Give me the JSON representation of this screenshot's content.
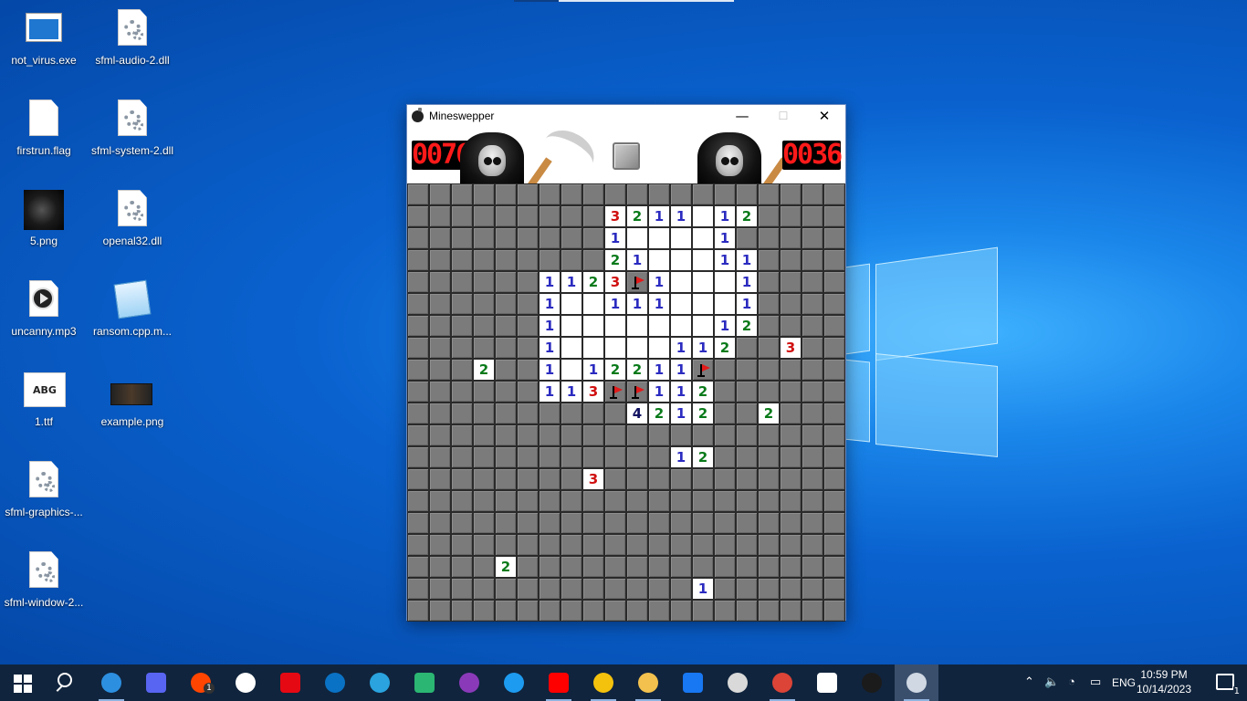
{
  "desktop": {
    "icons": [
      {
        "label": "not_virus.exe",
        "icon": "window-app-icon"
      },
      {
        "label": "sfml-audio-2.dll",
        "icon": "dll-gear-icon"
      },
      {
        "label": "firstrun.flag",
        "icon": "blank-file-icon"
      },
      {
        "label": "sfml-system-2.dll",
        "icon": "dll-gear-icon"
      },
      {
        "label": "5.png",
        "icon": "dark-face-image-icon"
      },
      {
        "label": "openal32.dll",
        "icon": "dll-gear-icon"
      },
      {
        "label": "uncanny.mp3",
        "icon": "audio-play-icon"
      },
      {
        "label": "ransom.cpp.m...",
        "icon": "notepad-file-icon"
      },
      {
        "label": "1.ttf",
        "icon": "font-file-icon",
        "glyph_text": "ABG"
      },
      {
        "label": "example.png",
        "icon": "image-thumbnail-icon"
      },
      {
        "label": "sfml-graphics-...",
        "icon": "dll-gear-icon"
      },
      {
        "label": "sfml-window-2...",
        "icon": "dll-gear-icon"
      }
    ]
  },
  "window": {
    "title": "Mineswepper",
    "minimize_glyph": "—",
    "maximize_glyph": "☐",
    "close_glyph": "✕",
    "left_counter": "0076",
    "right_counter": "0036",
    "counter_color": "#ff1a1a"
  },
  "board": {
    "cols": 20,
    "rows": 20,
    "legend": "H = hidden, O = open empty, F = flag, 1-4 = number",
    "grid": [
      "HHHHHHHHHHHHHHHHHHHH",
      "HHHHHHHHH3211 12HHHH",
      "HHHHHHHHH1OOOO1HHHHH",
      "HHHHHHHHH21OOO11HHHH",
      "HHHHHH1123F1OOO1HHHH",
      "HHHHHH1OO111OOO1HHHH",
      "HHHHHH1OOOOOOO12HHHH",
      "HHHHHH1OOOOO112HH3HH",
      "HHH2HH1O12211FHHHHHH",
      "HHHHHH113FF112HHHHHH",
      "HHHHHHHHHH4212HH2HHH",
      "HHHHHHHHHHHHHHHHHHHH",
      "HHHHHHHHHHHH12HHHHHH",
      "HHHHHHHH3HHHHHHHHHHH",
      "HHHHHHHHHHHHHHHHHHHH",
      "HHHHHHHHHHHHHHHHHHHH",
      "HHHHHHHHHHHHHHHHHHHH",
      "HHHH2HHHHHHHHHHHHHHH",
      "HHHHHHHHHHHHH1HHHHHH",
      "HHHHHHHHHHHHHHHHHHHH"
    ],
    "number_colors": {
      "1": "#2b2bc0",
      "2": "#0a7a1a",
      "3": "#d01010",
      "4": "#101060"
    }
  },
  "taskbar": {
    "apps": [
      {
        "name": "start-button",
        "color": "#ffffff"
      },
      {
        "name": "search-button",
        "color": "#ffffff"
      },
      {
        "name": "vscode-app",
        "color": "#2d8fe0"
      },
      {
        "name": "discord-app",
        "color": "#5865f2"
      },
      {
        "name": "reddit-app",
        "color": "#ff4500",
        "badge": "1"
      },
      {
        "name": "wordpress-app",
        "color": "#ffffff"
      },
      {
        "name": "netflix-app",
        "color": "#e50914"
      },
      {
        "name": "outlook-app",
        "color": "#0a72c4"
      },
      {
        "name": "telegram-app",
        "color": "#2aa3de"
      },
      {
        "name": "edge-app",
        "color": "#2bb673"
      },
      {
        "name": "podcast-app",
        "color": "#8a3ab9"
      },
      {
        "name": "twitter-app",
        "color": "#1d9bf0"
      },
      {
        "name": "youtube-app",
        "color": "#ff0000"
      },
      {
        "name": "chrome-app",
        "color": "#f4c20d"
      },
      {
        "name": "file-explorer-app",
        "color": "#f2c14e"
      },
      {
        "name": "facebook-app",
        "color": "#1877f2"
      },
      {
        "name": "openai-app",
        "color": "#d9d9d9"
      },
      {
        "name": "chrome-profile-app",
        "color": "#db4437"
      },
      {
        "name": "security-app",
        "color": "#ffffff"
      },
      {
        "name": "terminal-app",
        "color": "#1b1b1b"
      },
      {
        "name": "minesweeper-app",
        "color": "#cfd8e3"
      }
    ],
    "tray": {
      "language": "ENG",
      "time": "10:59 PM",
      "date": "10/14/2023",
      "notification_count": "1"
    }
  }
}
